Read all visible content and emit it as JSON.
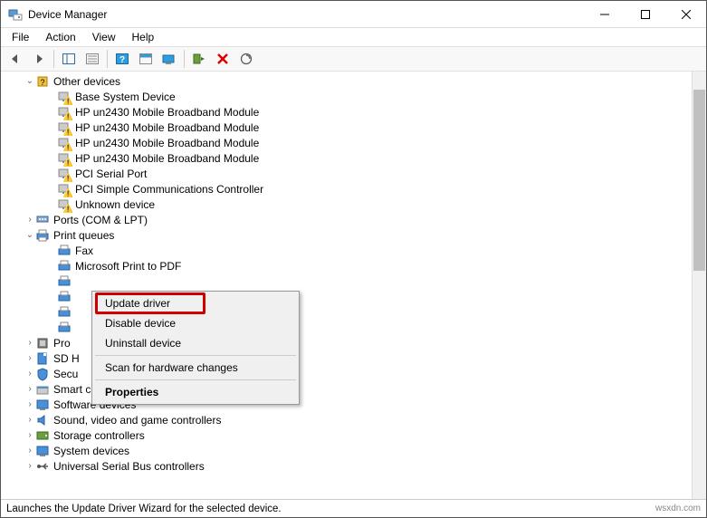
{
  "window": {
    "title": "Device Manager"
  },
  "menu": {
    "file": "File",
    "action": "Action",
    "view": "View",
    "help": "Help"
  },
  "tree": {
    "other_devices": "Other devices",
    "items_other": [
      "Base System Device",
      "HP un2430 Mobile Broadband Module",
      "HP un2430 Mobile Broadband Module",
      "HP un2430 Mobile Broadband Module",
      "HP un2430 Mobile Broadband Module",
      "PCI Serial Port",
      "PCI Simple Communications Controller",
      "Unknown device"
    ],
    "ports": "Ports (COM & LPT)",
    "print_queues": "Print queues",
    "items_print": [
      "Fax",
      "Microsoft Print to PDF"
    ],
    "proc": "Pro",
    "sdh": "SD H",
    "sec": "Secu",
    "smart": "Smart card readers",
    "software": "Software devices",
    "sound": "Sound, video and game controllers",
    "storage": "Storage controllers",
    "system": "System devices",
    "usb": "Universal Serial Bus controllers"
  },
  "context": {
    "update": "Update driver",
    "disable": "Disable device",
    "uninstall": "Uninstall device",
    "scan": "Scan for hardware changes",
    "properties": "Properties"
  },
  "status": {
    "text": "Launches the Update Driver Wizard for the selected device.",
    "watermark": "wsxdn.com"
  }
}
